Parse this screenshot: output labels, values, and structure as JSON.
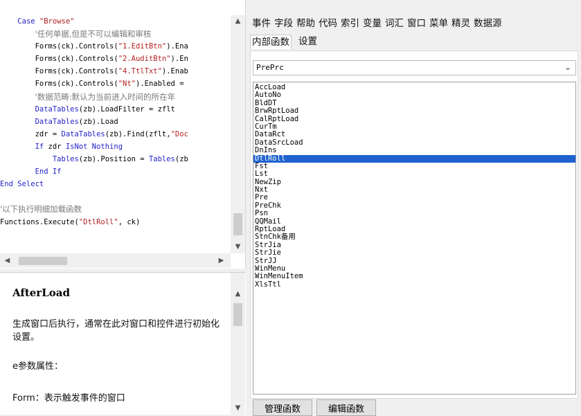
{
  "code_lines": [
    {
      "indent": "    ",
      "parts": [
        {
          "t": "Case ",
          "c": "kw"
        },
        {
          "t": "\"Browse\"",
          "c": "str"
        }
      ]
    },
    {
      "indent": "        ",
      "parts": [
        {
          "t": "'任何单据,但是不可以编辑和审核",
          "c": "cm"
        }
      ]
    },
    {
      "indent": "        ",
      "parts": [
        {
          "t": "Forms(ck).Controls(",
          "c": ""
        },
        {
          "t": "\"1.EditBtn\"",
          "c": "str"
        },
        {
          "t": ").Ena",
          "c": ""
        }
      ]
    },
    {
      "indent": "        ",
      "parts": [
        {
          "t": "Forms(ck).Controls(",
          "c": ""
        },
        {
          "t": "\"2.AuditBtn\"",
          "c": "str"
        },
        {
          "t": ").En",
          "c": ""
        }
      ]
    },
    {
      "indent": "        ",
      "parts": [
        {
          "t": "Forms(ck).Controls(",
          "c": ""
        },
        {
          "t": "\"4.TtlTxt\"",
          "c": "str"
        },
        {
          "t": ").Enab",
          "c": ""
        }
      ]
    },
    {
      "indent": "        ",
      "parts": [
        {
          "t": "Forms(ck).Controls(",
          "c": ""
        },
        {
          "t": "\"Nt\"",
          "c": "str"
        },
        {
          "t": ").Enabled =",
          "c": ""
        }
      ]
    },
    {
      "indent": "        ",
      "parts": [
        {
          "t": "'数据范畴:默认为当前进入时间的所在年",
          "c": "cm"
        }
      ]
    },
    {
      "indent": "        ",
      "parts": [
        {
          "t": "DataTables",
          "c": "kw"
        },
        {
          "t": "(zb).LoadFilter = zflt",
          "c": ""
        }
      ]
    },
    {
      "indent": "        ",
      "parts": [
        {
          "t": "DataTables",
          "c": "kw"
        },
        {
          "t": "(zb).Load",
          "c": ""
        }
      ]
    },
    {
      "indent": "        ",
      "parts": [
        {
          "t": "zdr = ",
          "c": ""
        },
        {
          "t": "DataTables",
          "c": "kw"
        },
        {
          "t": "(zb).Find(zflt,",
          "c": ""
        },
        {
          "t": "\"Doc",
          "c": "str"
        }
      ]
    },
    {
      "indent": "        ",
      "parts": [
        {
          "t": "If ",
          "c": "kw"
        },
        {
          "t": "zdr ",
          "c": ""
        },
        {
          "t": "IsNot Nothing",
          "c": "kw"
        }
      ]
    },
    {
      "indent": "            ",
      "parts": [
        {
          "t": "Tables",
          "c": "kw"
        },
        {
          "t": "(zb).Position = ",
          "c": ""
        },
        {
          "t": "Tables",
          "c": "kw"
        },
        {
          "t": "(zb",
          "c": ""
        }
      ]
    },
    {
      "indent": "        ",
      "parts": [
        {
          "t": "End If",
          "c": "kw"
        }
      ]
    },
    {
      "indent": "",
      "parts": [
        {
          "t": "End Select",
          "c": "kw"
        }
      ]
    },
    {
      "indent": "",
      "parts": []
    },
    {
      "indent": "",
      "parts": [
        {
          "t": "'以下执行明细加载函数",
          "c": "cm"
        }
      ]
    },
    {
      "indent": "",
      "parts": [
        {
          "t": "Functions.Execute(",
          "c": ""
        },
        {
          "t": "\"DtlRoll\"",
          "c": "str"
        },
        {
          "t": ", ck)",
          "c": ""
        }
      ]
    }
  ],
  "help": {
    "title": "AfterLoad",
    "desc": "生成窗口后执行，通常在此对窗口和控件进行初始化设置。",
    "params_label": "e参数属性：",
    "form_line": "Form：表示触发事件的窗口"
  },
  "tabs_row1": [
    "事件",
    "字段",
    "帮助",
    "代码",
    "索引",
    "变量",
    "词汇",
    "窗口",
    "菜单",
    "精灵",
    "数据源"
  ],
  "tabs_row2": [
    "内部函数",
    "设置"
  ],
  "selected_tab": "内部函数",
  "combo_value": "PrePrc",
  "functions": [
    "AccLoad",
    "AutoNo",
    "BldDT",
    "BrwRptLoad",
    "CalRptLoad",
    "CurTm",
    "DataRct",
    "DataSrcLoad",
    "DnIns",
    "DtlRoll",
    "Fst",
    "Lst",
    "NewZip",
    "Nxt",
    "Pre",
    "PreChk",
    "Psn",
    "QQMail",
    "RptLoad",
    "StnChk备用",
    "StrJia",
    "StrJie",
    "StrJJ",
    "WinMenu",
    "WinMenuItem",
    "XlsTtl"
  ],
  "selected_function": "DtlRoll",
  "buttons": {
    "manage": "管理函数",
    "edit": "编辑函数"
  },
  "colors": {
    "keyword": "#1f1fc8",
    "string": "#b02020",
    "comment": "#7a7a7a",
    "selection": "#1f62cf"
  },
  "icons": {
    "up": "triangle-up",
    "down": "triangle-down",
    "left": "triangle-left",
    "right": "triangle-right",
    "dropdown": "chevron-down"
  }
}
